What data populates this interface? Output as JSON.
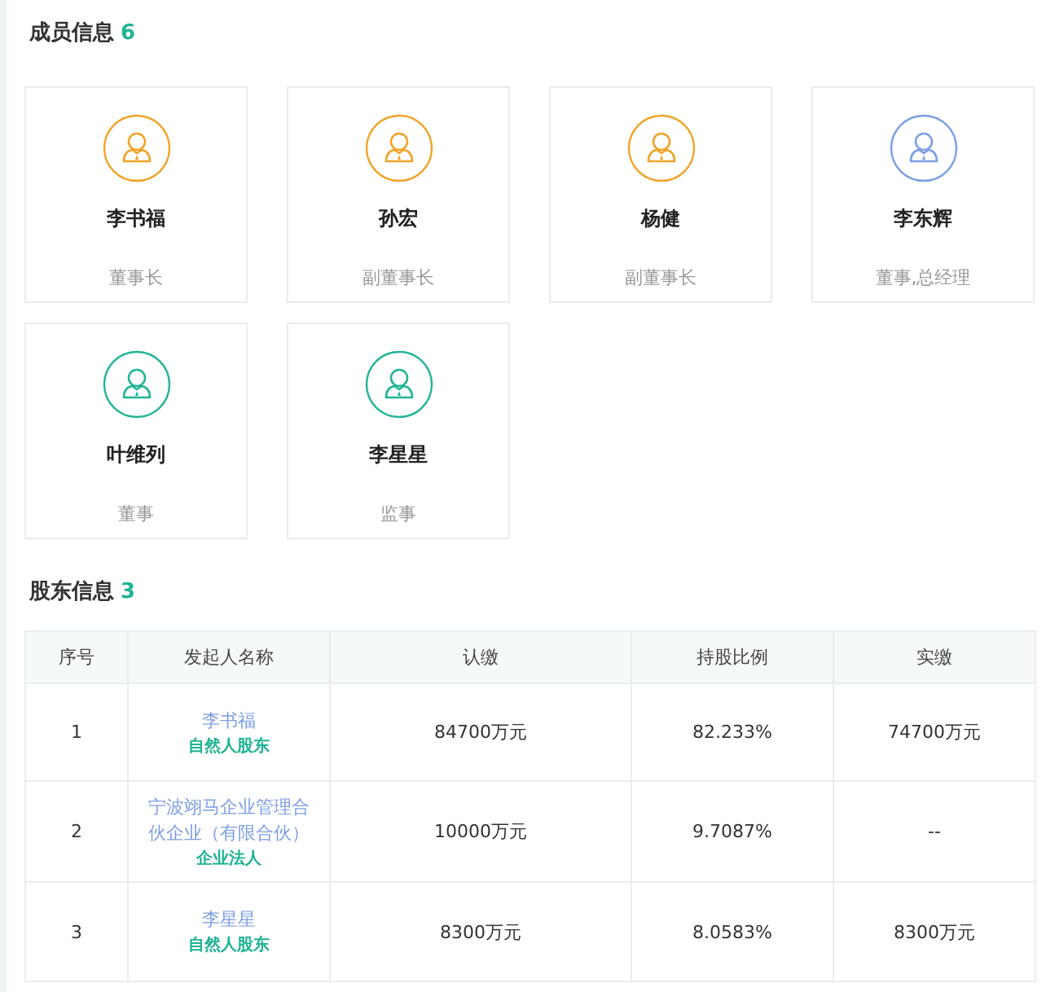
{
  "members_section": {
    "title": "成员信息",
    "count": "6"
  },
  "members": [
    {
      "name": "李书福",
      "role": "董事长",
      "color": "#f0a428"
    },
    {
      "name": "孙宏",
      "role": "副董事长",
      "color": "#f0a428"
    },
    {
      "name": "杨健",
      "role": "副董事长",
      "color": "#f0a428"
    },
    {
      "name": "李东辉",
      "role": "董事,总经理",
      "color": "#7d9fe3"
    },
    {
      "name": "叶维列",
      "role": "董事",
      "color": "#22b496"
    },
    {
      "name": "李星星",
      "role": "监事",
      "color": "#22b496"
    }
  ],
  "shareholders_section": {
    "title": "股东信息",
    "count": "3"
  },
  "table": {
    "columns": [
      "序号",
      "发起人名称",
      "认缴",
      "持股比例",
      "实缴"
    ],
    "rows": [
      {
        "index": "1",
        "name": "李书福",
        "type": "自然人股东",
        "subscribed": "84700万元",
        "ratio": "82.233%",
        "paid": "74700万元"
      },
      {
        "index": "2",
        "name": "宁波翊马企业管理合伙企业（有限合伙）",
        "type": "企业法人",
        "subscribed": "10000万元",
        "ratio": "9.7087%",
        "paid": "--"
      },
      {
        "index": "3",
        "name": "李星星",
        "type": "自然人股东",
        "subscribed": "8300万元",
        "ratio": "8.0583%",
        "paid": "8300万元"
      }
    ]
  }
}
